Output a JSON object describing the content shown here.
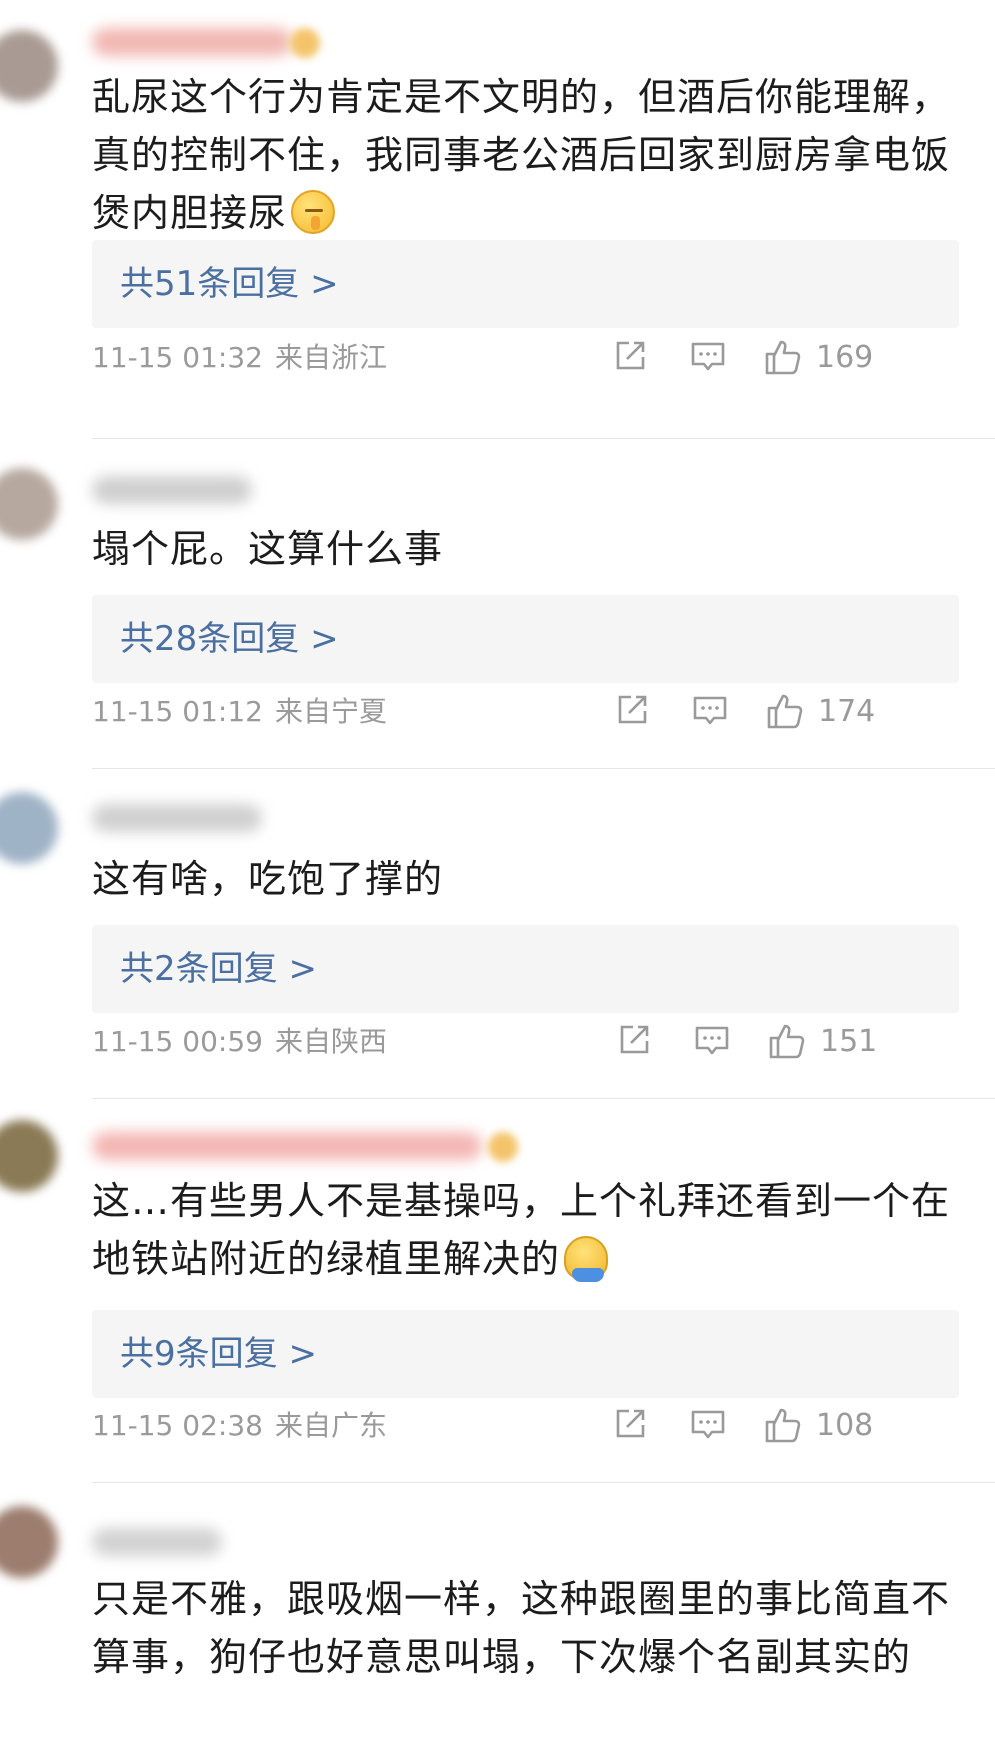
{
  "colors": {
    "reply_link": "#4a6fa0",
    "meta": "#9a9a9a",
    "reply_bg": "#f5f5f5"
  },
  "comments": [
    {
      "text": "乱尿这个行为肯定是不文明的，但酒后你能理解，真的控制不住，我同事老公酒后回家到厨房拿电饭煲内胆接尿",
      "emoji": "shushing-face-icon",
      "replies": "共51条回复 >",
      "time": "11-15 01:32",
      "location": "来自浙江",
      "likes": "169"
    },
    {
      "text": "塌个屁。这算什么事",
      "replies": "共28条回复 >",
      "time": "11-15 01:12",
      "location": "来自宁夏",
      "likes": "174"
    },
    {
      "text": "这有啥，吃饱了撑的",
      "replies": "共2条回复 >",
      "time": "11-15 00:59",
      "location": "来自陕西",
      "likes": "151"
    },
    {
      "text": "这…有些男人不是基操吗，上个礼拜还看到一个在地铁站附近的绿植里解决的",
      "emoji": "blob-hug-icon",
      "replies": "共9条回复 >",
      "time": "11-15 02:38",
      "location": "来自广东",
      "likes": "108"
    },
    {
      "text": "只是不雅，跟吸烟一样，这种跟圈里的事比简直不算事，狗仔也好意思叫塌，下次爆个名副其实的"
    }
  ]
}
